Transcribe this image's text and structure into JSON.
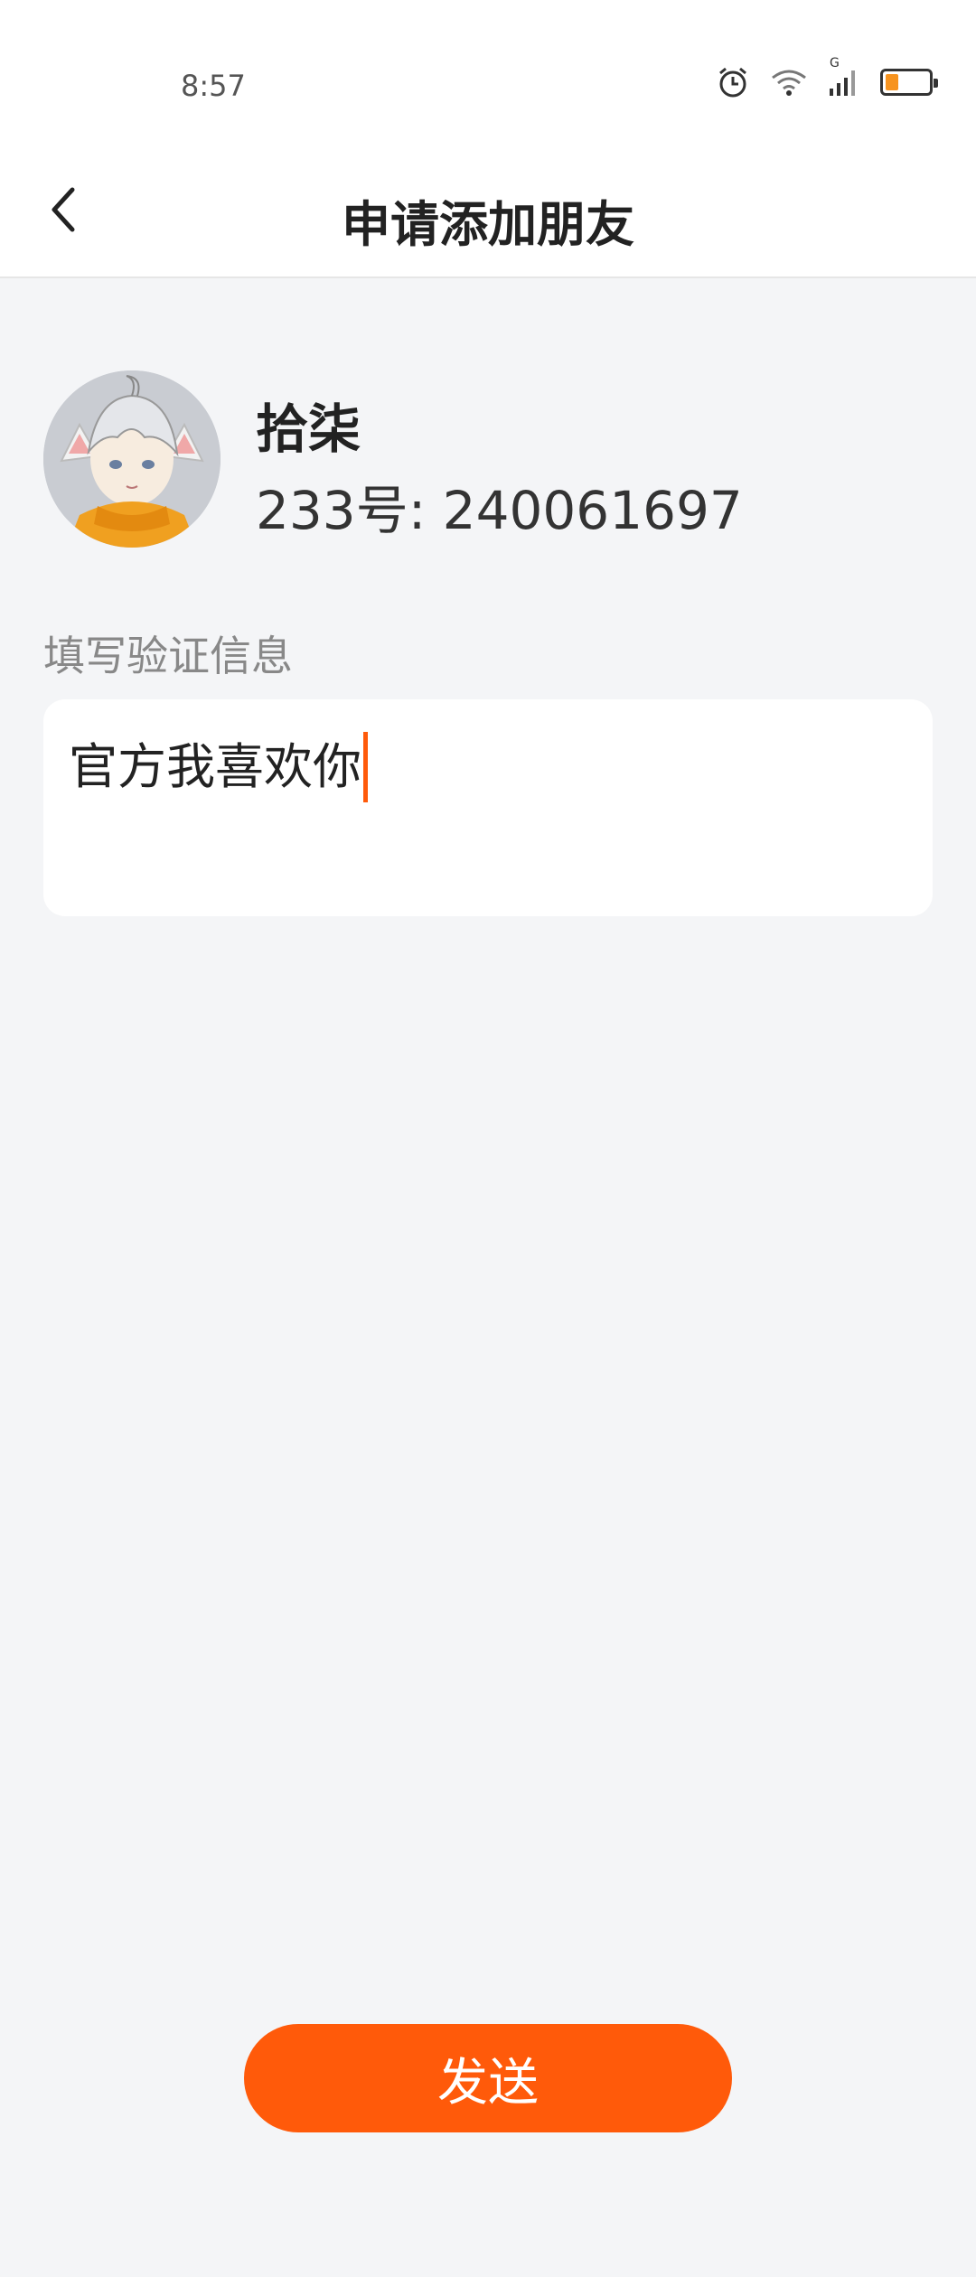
{
  "status_bar": {
    "time": "8:57",
    "signal_label": "G",
    "icons": [
      "alarm-icon",
      "wifi-icon",
      "cell-signal-icon",
      "battery-icon"
    ],
    "battery_level_percent": 30,
    "battery_color": "#f7931e"
  },
  "header": {
    "back_icon": "chevron-left-icon",
    "title": "申请添加朋友"
  },
  "profile": {
    "name": "拾柒",
    "id_text": "233号: 240061697"
  },
  "verification": {
    "label": "填写验证信息",
    "value": "官方我喜欢你"
  },
  "actions": {
    "send_label": "发送"
  },
  "colors": {
    "accent": "#ff5a0a",
    "background": "#f4f5f7"
  }
}
